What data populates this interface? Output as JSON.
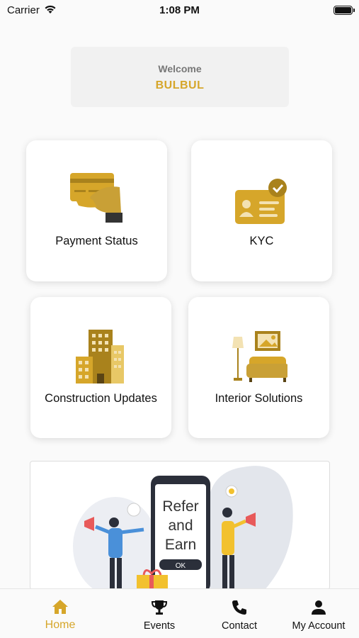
{
  "status_bar": {
    "carrier": "Carrier",
    "time": "1:08 PM"
  },
  "welcome": {
    "greeting": "Welcome",
    "user_name": "BULBUL"
  },
  "cards": {
    "payment_status": "Payment Status",
    "kyc": "KYC",
    "construction_updates": "Construction Updates",
    "interior_solutions": "Interior Solutions"
  },
  "banner": {
    "line1": "Refer",
    "line2": "and",
    "line3": "Earn",
    "button": "OK"
  },
  "tabs": {
    "home": "Home",
    "events": "Events",
    "contact": "Contact",
    "my_account": "My Account"
  },
  "colors": {
    "accent": "#d6a62a",
    "accent_dark": "#a9821c",
    "phone_dark": "#2b2f3a",
    "person_blue": "#4a90d9",
    "person_yellow": "#f2c12e",
    "banner_blob": "#e3e6ec"
  },
  "icons": {
    "wifi": "wifi-icon",
    "battery": "battery-icon",
    "payment": "credit-card-hand-icon",
    "kyc": "id-card-check-icon",
    "construction": "buildings-icon",
    "interior": "sofa-lamp-icon",
    "home": "home-icon",
    "events": "trophy-icon",
    "contact": "phone-icon",
    "account": "person-icon"
  }
}
